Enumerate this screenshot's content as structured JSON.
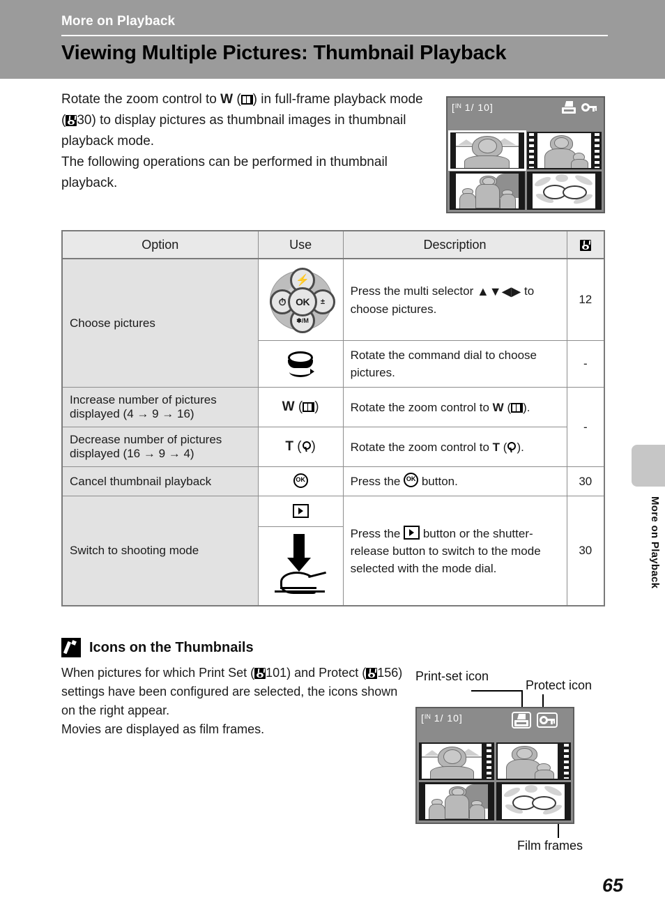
{
  "header": {
    "kicker": "More on Playback",
    "title": "Viewing Multiple Pictures: Thumbnail Playback"
  },
  "intro": {
    "line1_a": "Rotate the zoom control to ",
    "line1_w": "W",
    "line1_b": ") in full-frame playback mode (",
    "line1_page": "30",
    "line1_c": ") to display pictures as thumbnail images in thumbnail playback mode.",
    "line2": "The following operations can be performed in thumbnail playback."
  },
  "lcd_top": {
    "status_bracket_open": "[",
    "status_in": "IN",
    "status_counter": "1/  10",
    "status_bracket_close": "]",
    "print_icon": "print-set-icon",
    "protect_icon": "protect-icon",
    "thumbnails": [
      {
        "name": "woman-portrait-landscape",
        "selected": true,
        "film": false
      },
      {
        "name": "mother-and-child-movie",
        "selected": false,
        "film": true
      },
      {
        "name": "family-outdoor",
        "selected": false,
        "film": false
      },
      {
        "name": "flowers",
        "selected": false,
        "film": false
      }
    ]
  },
  "table": {
    "headers": {
      "option": "Option",
      "use": "Use",
      "description": "Description",
      "reference": "page-reference-icon"
    },
    "rows": [
      {
        "option": "Choose pictures",
        "use_icon": "multi-selector",
        "desc_a": "Press the multi selector ",
        "desc_arrows": "▲▼◀▶",
        "desc_b": " to choose pictures.",
        "ref": "12"
      },
      {
        "option": "",
        "use_icon": "command-dial",
        "desc_a": "Rotate the command dial to choose pictures.",
        "ref": "-"
      },
      {
        "option_a": "Increase number of pictures displayed (4 ",
        "option_arrow1": "→",
        "option_b": " 9 ",
        "option_arrow2": "→",
        "option_c": " 16)",
        "use_label": "W",
        "use_icon": "thumbnail-4-icon",
        "desc_a": "Rotate the zoom control to ",
        "desc_w": "W",
        "desc_b": ").",
        "ref": "-"
      },
      {
        "option_a": "Decrease number of pictures displayed (16 ",
        "option_arrow1": "→",
        "option_b": " 9 ",
        "option_arrow2": "→",
        "option_c": " 4)",
        "use_label": "T",
        "use_icon": "magnify-icon",
        "desc_a": "Rotate the zoom control to ",
        "desc_t": "T",
        "desc_b": ").",
        "ref": ""
      },
      {
        "option": "Cancel thumbnail playback",
        "use_icon": "ok-button-icon",
        "desc_a": "Press the ",
        "desc_b": " button.",
        "ref": "30"
      },
      {
        "option": "Switch to shooting mode",
        "use_icon_1": "playback-button-icon",
        "use_icon_2": "shutter-release-press-icon",
        "desc_a": "Press the ",
        "desc_b": " button or the shutter-release button to switch to the mode selected with the mode dial.",
        "ref": "30"
      }
    ]
  },
  "note": {
    "title": "Icons on the Thumbnails",
    "body_a": "When pictures for which Print Set (",
    "body_page1": "101",
    "body_b": ") and Protect (",
    "body_page2": "156",
    "body_c": ") settings have been configured are selected, the icons shown on the right appear.",
    "body_d": "Movies are displayed as film frames."
  },
  "callouts": {
    "print_set": "Print-set icon",
    "protect": "Protect icon",
    "film_frames": "Film frames"
  },
  "lcd_bottom": {
    "status_bracket_open": "[",
    "status_in": "IN",
    "status_counter": "1/  10",
    "status_bracket_close": "]"
  },
  "sidetab": {
    "label": "More on Playback"
  },
  "page_number": "65"
}
